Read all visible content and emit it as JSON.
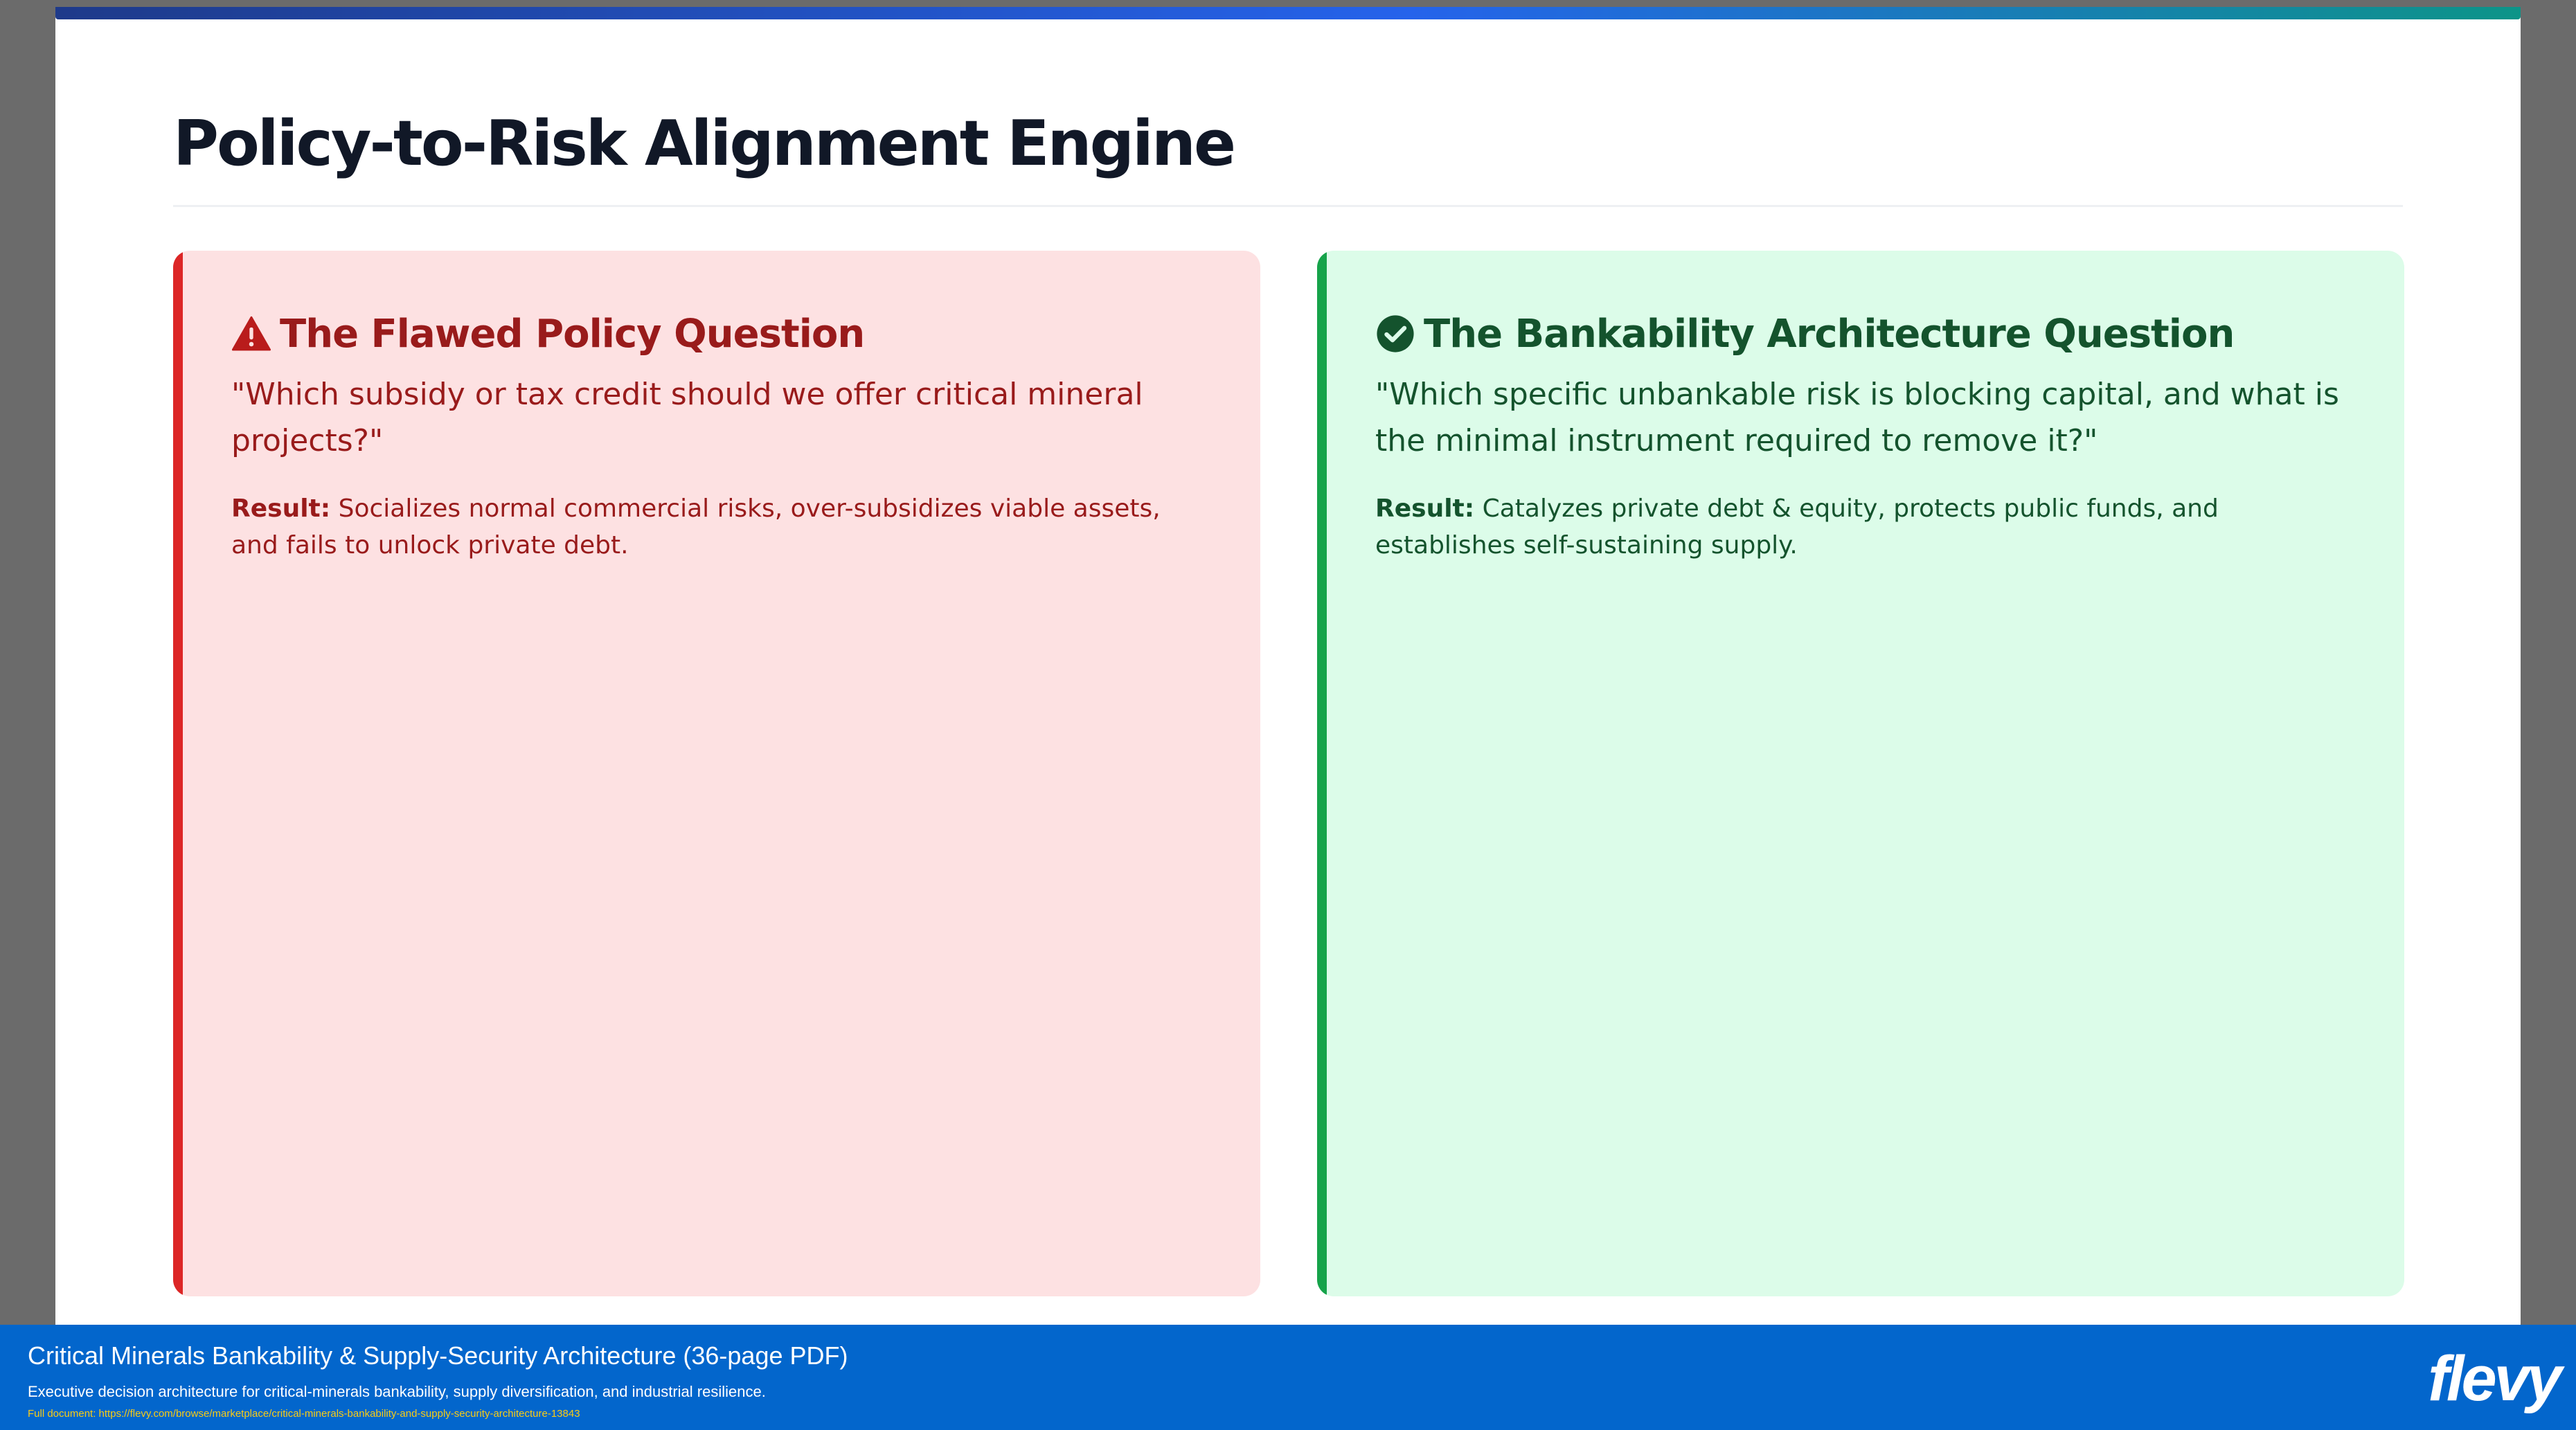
{
  "slide": {
    "title": "Policy-to-Risk Alignment Engine"
  },
  "cards": {
    "flawed": {
      "icon": "warning-triangle-icon",
      "heading": "The Flawed Policy Question",
      "quote": "\"Which subsidy or tax credit should we offer critical mineral projects?\"",
      "result_label": "Result:",
      "result_text": "Socializes normal commercial risks, over-subsidizes viable assets, and fails to unlock private debt.",
      "accent_color": "#dc2626",
      "background_color": "#fde1e2"
    },
    "bankability": {
      "icon": "check-circle-icon",
      "heading": "The Bankability Architecture Question",
      "quote": "\"Which specific unbankable risk is blocking capital, and what is the minimal instrument required to remove it?\"",
      "result_label": "Result:",
      "result_text": "Catalyzes private debt & equity, protects public funds, and establishes self-sustaining supply.",
      "accent_color": "#16a34a",
      "background_color": "#dcfce9"
    }
  },
  "footer": {
    "doc_title": "Critical Minerals Bankability & Supply-Security Architecture",
    "doc_pages": "(36-page PDF)",
    "description": "Executive decision architecture for critical-minerals bankability, supply diversification, and industrial resilience.",
    "link": "Full document: https://flevy.com/browse/marketplace/critical-minerals-bankability-and-supply-security-architecture-13843",
    "brand": "flevy",
    "background_color": "#0366cc"
  }
}
